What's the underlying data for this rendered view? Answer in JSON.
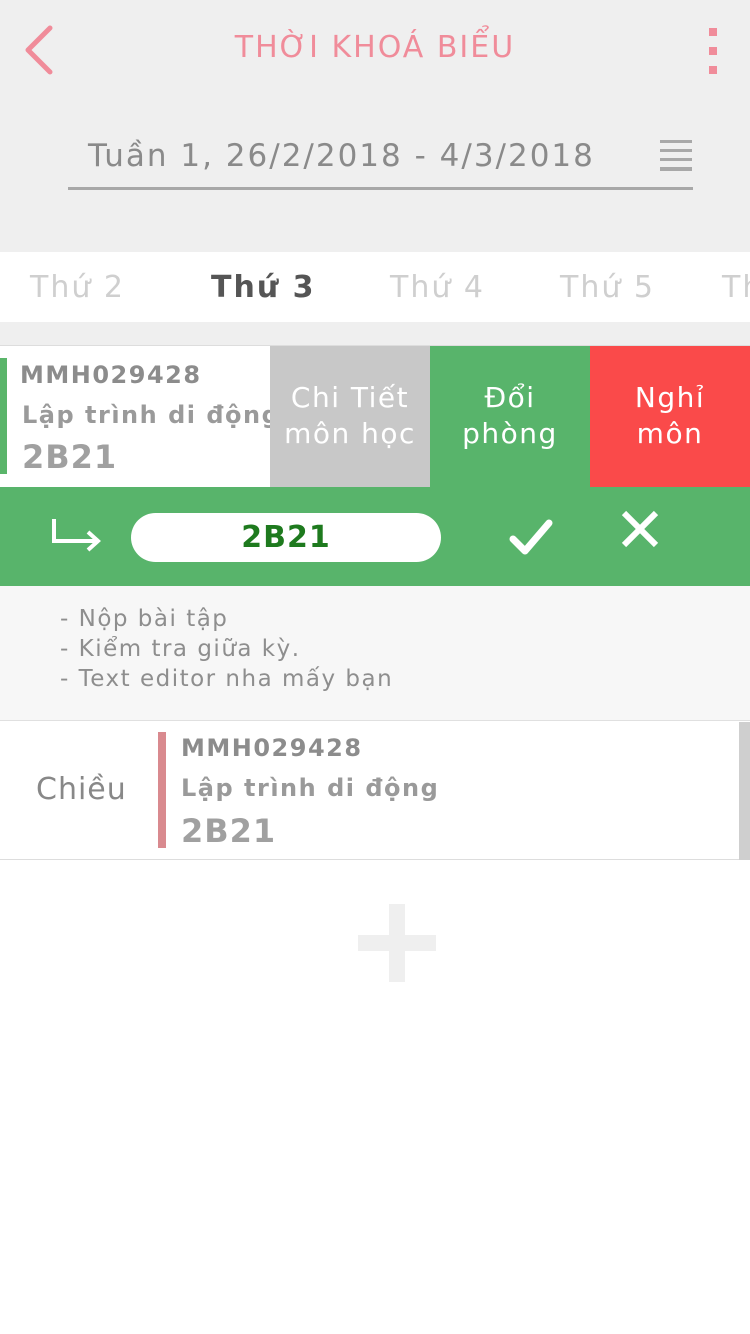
{
  "header": {
    "title": "THỜI KHOÁ BIỂU",
    "week": "Tuần 1, 26/2/2018 - 4/3/2018",
    "accent_color": "#f08c9a"
  },
  "tabs": [
    {
      "label": "Thứ 2",
      "active": false
    },
    {
      "label": "Thứ 3",
      "active": true
    },
    {
      "label": "Thứ 4",
      "active": false
    },
    {
      "label": "Thứ 5",
      "active": false
    },
    {
      "label": "Th",
      "active": false
    }
  ],
  "lesson_card": {
    "code": "MMH029428",
    "subject": "Lập trình di động",
    "room": "2B21",
    "bar_color": "#5ab56a"
  },
  "actions": {
    "detail": {
      "line1": "Chi Tiết",
      "line2": "môn học",
      "color": "#c8c8c8"
    },
    "change_room": {
      "line1": "Đổi",
      "line2": "phòng",
      "color": "#58b46b"
    },
    "cancel_class": {
      "line1": "Nghỉ",
      "line2": "môn",
      "color": "#fa4a4a"
    }
  },
  "edit_room": {
    "value": "2B21",
    "icons": {
      "arrow": "return-arrow-icon",
      "confirm": "checkmark-icon",
      "cancel": "close-icon"
    }
  },
  "notes": [
    "- Nộp bài tập",
    "- Kiểm tra giữa kỳ.",
    "- Text editor nha mấy bạn"
  ],
  "afternoon_card": {
    "session": "Chiều",
    "code": "MMH029428",
    "subject": "Lập trình di động",
    "room": "2B21",
    "bar_color": "#d98a8f"
  },
  "add_button": {
    "icon": "plus-icon"
  }
}
